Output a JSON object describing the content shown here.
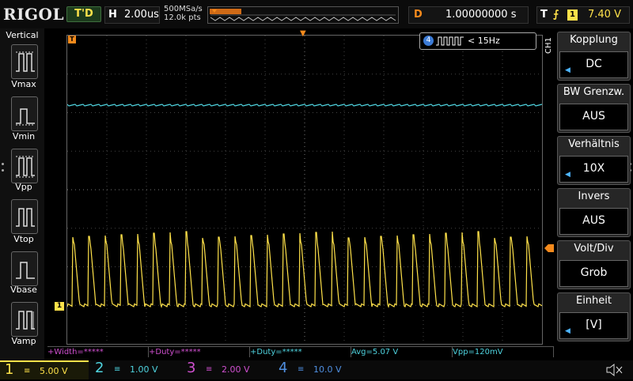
{
  "header": {
    "brand": "RIGOL",
    "run_state": "T'D",
    "horizontal_label": "H",
    "timebase": "2.00us",
    "sample_rate": "500MSa/s",
    "memory_depth": "12.0k pts",
    "delay_label": "D",
    "delay": "1.00000000 s",
    "trigger_label": "T",
    "trigger_edge_symbol": "⨍",
    "trigger_channel": "1",
    "trigger_level": "7.40 V"
  },
  "left_panel": {
    "title": "Vertical",
    "items": [
      {
        "label": "Vmax"
      },
      {
        "label": "Vmin"
      },
      {
        "label": "Vpp"
      },
      {
        "label": "Vtop"
      },
      {
        "label": "Vbase"
      },
      {
        "label": "Vamp"
      }
    ]
  },
  "freq_counter": {
    "channel": "4",
    "text": "< 15Hz"
  },
  "right_panel": {
    "channel_tag": "CH1",
    "items": [
      {
        "title": "Kopplung",
        "value": "DC"
      },
      {
        "title": "BW Grenzw.",
        "value": "AUS"
      },
      {
        "title": "Verhältnis",
        "value": "10X"
      },
      {
        "title": "Invers",
        "value": "AUS"
      },
      {
        "title": "Volt/Div",
        "value": "Grob"
      },
      {
        "title": "Einheit",
        "value": "[V]"
      }
    ]
  },
  "measurements": [
    {
      "text": "+Width=*****",
      "color": "#d050d0"
    },
    {
      "text": "+Duty=*****",
      "color": "#d050d0"
    },
    {
      "text": "+Duty=*****",
      "color": "#4fd4e0"
    },
    {
      "text": "Avg=5.07 V",
      "color": "#4fd4e0"
    },
    {
      "text": "Vpp=120mV",
      "color": "#4fd4e0"
    }
  ],
  "channels": [
    {
      "num": "1",
      "coupling": "≡",
      "scale": "5.00 V",
      "color": "#ffe24a"
    },
    {
      "num": "2",
      "coupling": "≡",
      "scale": "1.00 V",
      "color": "#4fd4e0"
    },
    {
      "num": "3",
      "coupling": "≡",
      "scale": "2.00 V",
      "color": "#d050d0"
    },
    {
      "num": "4",
      "coupling": "≡",
      "scale": "10.0 V",
      "color": "#4f8fe0"
    }
  ],
  "markers": {
    "trigger_pos": "T",
    "ch1_marker": "1"
  },
  "colors": {
    "ch1": "#ffe24a",
    "ch2": "#4fd4e0",
    "ch3": "#d050d0",
    "ch4": "#4f8fe0",
    "accent": "#f48a1c"
  }
}
